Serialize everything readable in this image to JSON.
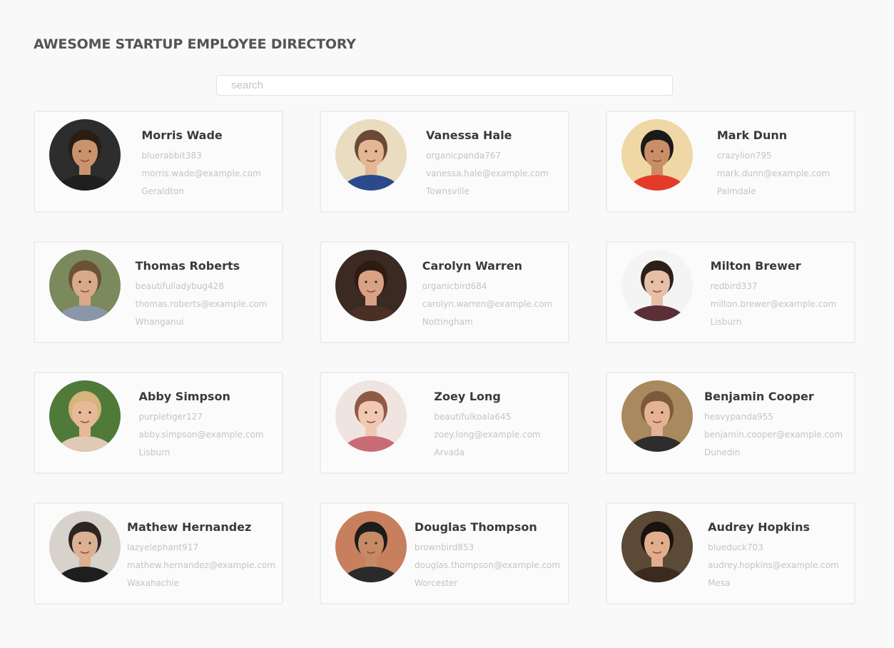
{
  "header": {
    "title": "AWESOME STARTUP EMPLOYEE DIRECTORY"
  },
  "search": {
    "placeholder": "search",
    "value": ""
  },
  "employees": [
    {
      "name": "Morris Wade",
      "username": "bluerabbit383",
      "email": "morris.wade@example.com",
      "city": "Geraldton",
      "avatar": {
        "bg": "#2d2d2d",
        "skin": "#c9936e",
        "hair": "#2a1d14",
        "shirt": "#1f1f1f"
      }
    },
    {
      "name": "Vanessa Hale",
      "username": "organicpanda767",
      "email": "vanessa.hale@example.com",
      "city": "Townsville",
      "avatar": {
        "bg": "#e9dcc1",
        "skin": "#e4b694",
        "hair": "#6a4a36",
        "shirt": "#2b4a8c"
      }
    },
    {
      "name": "Mark Dunn",
      "username": "crazylion795",
      "email": "mark.dunn@example.com",
      "city": "Palmdale",
      "avatar": {
        "bg": "#efd7a6",
        "skin": "#c98e66",
        "hair": "#1a1a1a",
        "shirt": "#e23b2a"
      }
    },
    {
      "name": "Thomas Roberts",
      "username": "beautifulladybug428",
      "email": "thomas.roberts@example.com",
      "city": "Whanganui",
      "avatar": {
        "bg": "#7b8a5c",
        "skin": "#d8a98a",
        "hair": "#6a5238",
        "shirt": "#8a97a8"
      }
    },
    {
      "name": "Carolyn Warren",
      "username": "organicbird684",
      "email": "carolyn.warren@example.com",
      "city": "Nottingham",
      "avatar": {
        "bg": "#3a2a22",
        "skin": "#d9a285",
        "hair": "#2e1c14",
        "shirt": "#4a3024"
      }
    },
    {
      "name": "Milton Brewer",
      "username": "redbird337",
      "email": "milton.brewer@example.com",
      "city": "Lisburn",
      "avatar": {
        "bg": "#f4f4f4",
        "skin": "#e6bfa6",
        "hair": "#2b211b",
        "shirt": "#5c2f38"
      }
    },
    {
      "name": "Abby Simpson",
      "username": "purpletiger127",
      "email": "abby.simpson@example.com",
      "city": "Lisburn",
      "avatar": {
        "bg": "#4f7a3a",
        "skin": "#e8b999",
        "hair": "#d6b47a",
        "shirt": "#e0c9b5"
      }
    },
    {
      "name": "Zoey Long",
      "username": "beautifulkoala645",
      "email": "zoey.long@example.com",
      "city": "Arvada",
      "avatar": {
        "bg": "#f0e4e0",
        "skin": "#f1c8b2",
        "hair": "#8e5a44",
        "shirt": "#c96b75"
      }
    },
    {
      "name": "Benjamin Cooper",
      "username": "heavypanda955",
      "email": "benjamin.cooper@example.com",
      "city": "Dunedin",
      "avatar": {
        "bg": "#a88a5e",
        "skin": "#e5b394",
        "hair": "#7a5a3a",
        "shirt": "#2d2d2d"
      }
    },
    {
      "name": "Mathew Hernandez",
      "username": "lazyelephant917",
      "email": "mathew.hernandez@example.com",
      "city": "Waxahachie",
      "avatar": {
        "bg": "#d7d3cc",
        "skin": "#dcb092",
        "hair": "#2e2520",
        "shirt": "#1e1e1e"
      }
    },
    {
      "name": "Douglas Thompson",
      "username": "brownbird853",
      "email": "douglas.thompson@example.com",
      "city": "Worcester",
      "avatar": {
        "bg": "#c87f5e",
        "skin": "#c68a66",
        "hair": "#1c1c1c",
        "shirt": "#2a2a2a"
      }
    },
    {
      "name": "Audrey Hopkins",
      "username": "blueduck703",
      "email": "audrey.hopkins@example.com",
      "city": "Mesa",
      "avatar": {
        "bg": "#5a4a36",
        "skin": "#e1ad8a",
        "hair": "#1a120e",
        "shirt": "#3a2a20"
      }
    }
  ]
}
